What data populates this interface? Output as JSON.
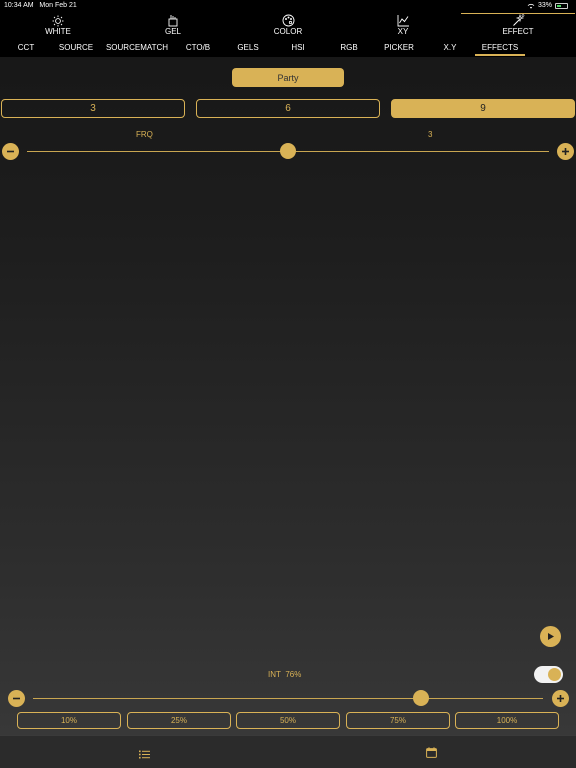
{
  "status": {
    "time": "10:34 AM",
    "date": "Mon Feb 21",
    "battery": "33%",
    "battery_level": 0.33
  },
  "main_tabs": [
    {
      "label": "WHITE",
      "icon": "sun-icon"
    },
    {
      "label": "GEL",
      "icon": "gel-icon"
    },
    {
      "label": "COLOR",
      "icon": "palette-icon"
    },
    {
      "label": "XY",
      "icon": "chart-icon"
    },
    {
      "label": "EFFECT",
      "icon": "magic-wand-icon",
      "active": true
    }
  ],
  "sub_tabs": [
    {
      "label": "CCT"
    },
    {
      "label": "SOURCE"
    },
    {
      "label": "SOURCEMATCH"
    },
    {
      "label": "CTO/B"
    },
    {
      "label": "GELS"
    },
    {
      "label": "HSI"
    },
    {
      "label": "RGB"
    },
    {
      "label": "PICKER"
    },
    {
      "label": "X.Y"
    },
    {
      "label": "EFFECTS",
      "active": true
    }
  ],
  "effect": {
    "preset_label": "Party",
    "segments": [
      "3",
      "6",
      "9"
    ],
    "selected_segment": "9",
    "frq_label": "FRQ",
    "frq_value": "3",
    "frq_slider_fraction": 0.5
  },
  "intensity": {
    "label": "INT",
    "value": "76%",
    "slider_fraction": 0.76,
    "toggle_on": true,
    "presets": [
      "10%",
      "25%",
      "50%",
      "75%",
      "100%"
    ]
  },
  "colors": {
    "accent": "#d9b256",
    "background": "#1d1d1d"
  }
}
